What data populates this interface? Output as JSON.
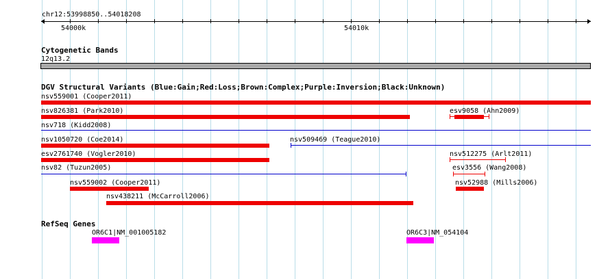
{
  "ruler": {
    "location": "chr12:53998850..54018208",
    "tick_labels": [
      "54000k",
      "54010k"
    ]
  },
  "cytoband": {
    "title": "Cytogenetic Bands",
    "band_label": "12q13.2"
  },
  "dgv": {
    "title": "DGV Structural Variants (Blue:Gain;Red:Loss;Brown:Complex;Purple:Inversion;Black:Unknown)",
    "colors": {
      "gain": "#0000cc",
      "loss": "#ee0000"
    },
    "variants": [
      {
        "id": "nsv559001",
        "label": "nsv559001 (Cooper2011)",
        "type": "loss",
        "style": "bar"
      },
      {
        "id": "nsv826381",
        "label": "nsv826381 (Park2010)",
        "type": "loss",
        "style": "bar"
      },
      {
        "id": "esv9058",
        "label": "esv9058 (Ahn2009)",
        "type": "loss",
        "style": "bar-with-whiskers"
      },
      {
        "id": "nsv718",
        "label": "nsv718 (Kidd2008)",
        "type": "gain",
        "style": "line"
      },
      {
        "id": "nsv1050720",
        "label": "nsv1050720 (Coe2014)",
        "type": "loss",
        "style": "bar"
      },
      {
        "id": "nsv509469",
        "label": "nsv509469 (Teague2010)",
        "type": "gain",
        "style": "line"
      },
      {
        "id": "esv2761740",
        "label": "esv2761740 (Vogler2010)",
        "type": "loss",
        "style": "bar"
      },
      {
        "id": "nsv512275",
        "label": "nsv512275 (Arlt2011)",
        "type": "loss",
        "style": "line"
      },
      {
        "id": "nsv82",
        "label": "nsv82 (Tuzun2005)",
        "type": "gain",
        "style": "line"
      },
      {
        "id": "esv3556",
        "label": "esv3556 (Wang2008)",
        "type": "loss",
        "style": "line"
      },
      {
        "id": "nsv559002",
        "label": "nsv559002 (Cooper2011)",
        "type": "loss",
        "style": "bar"
      },
      {
        "id": "nsv52988",
        "label": "nsv52988 (Mills2006)",
        "type": "loss",
        "style": "bar"
      },
      {
        "id": "nsv438211",
        "label": "nsv438211 (McCarroll2006)",
        "type": "loss",
        "style": "bar"
      }
    ]
  },
  "refseq": {
    "title": "RefSeq Genes",
    "color": "#ff00ff",
    "genes": [
      {
        "id": "OR6C1",
        "label": "OR6C1|NM_001005182"
      },
      {
        "id": "OR6C3",
        "label": "OR6C3|NM_054104"
      }
    ]
  }
}
